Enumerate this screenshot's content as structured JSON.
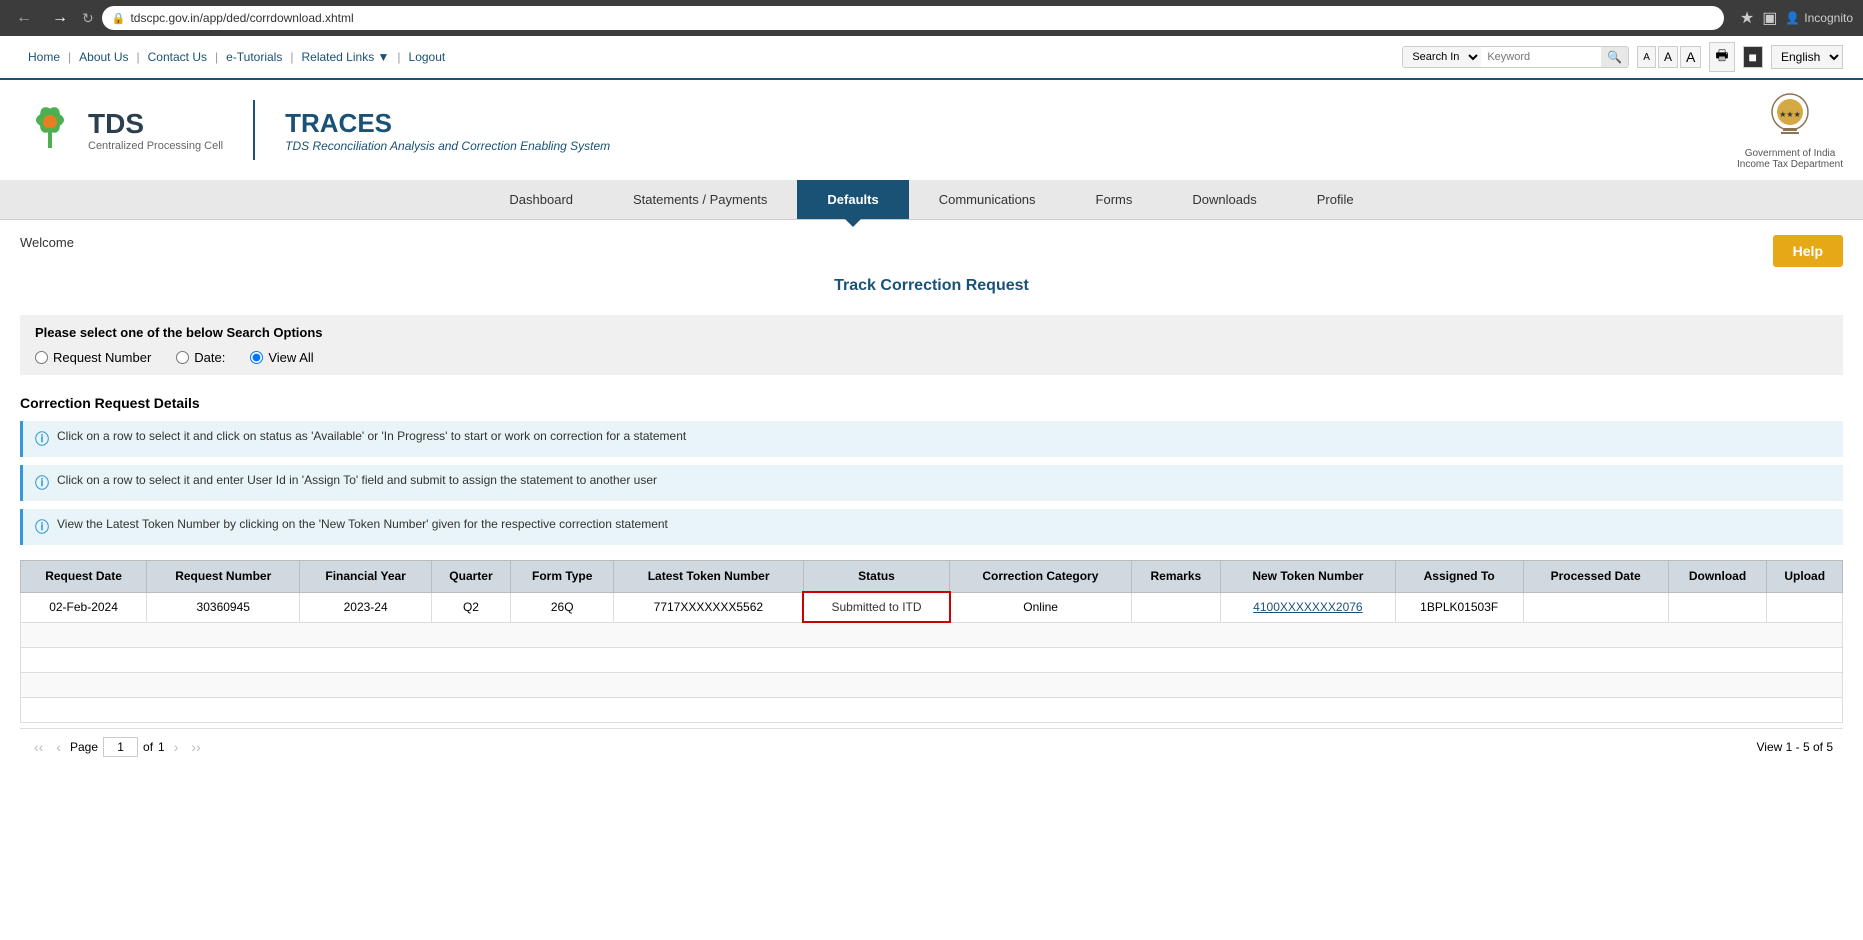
{
  "browser": {
    "url": "tdscpc.gov.in/app/ded/corrdownload.xhtml",
    "incognito_label": "Incognito"
  },
  "top_nav": {
    "links": [
      "Home",
      "About Us",
      "Contact Us",
      "e-Tutorials",
      "Related Links",
      "Logout"
    ],
    "search_label": "Search In",
    "search_placeholder": "Keyword",
    "font_btns": [
      "A",
      "A",
      "A"
    ],
    "language": "English"
  },
  "header": {
    "tds_title": "TDS",
    "tds_sub": "Centralized Processing Cell",
    "traces_title": "TRACES",
    "traces_sub": "TDS Reconciliation Analysis and Correction Enabling System",
    "govt_line1": "Government of India",
    "govt_line2": "Income Tax Department"
  },
  "main_nav": {
    "items": [
      "Dashboard",
      "Statements / Payments",
      "Defaults",
      "Communications",
      "Forms",
      "Downloads",
      "Profile"
    ],
    "active": "Defaults"
  },
  "content": {
    "welcome": "Welcome",
    "help_btn": "Help",
    "page_title": "Track Correction Request",
    "search_options_title": "Please select one of the below Search Options",
    "search_options": [
      "Request Number",
      "Date:",
      "View All"
    ],
    "selected_option": "View All",
    "correction_details_title": "Correction Request Details",
    "info_messages": [
      "Click on a row to select it and click on status as 'Available' or 'In Progress' to start or work on correction for a statement",
      "Click on a row to select it and enter User Id in 'Assign To' field and submit to assign the statement to another user",
      "View the Latest Token Number by clicking on the 'New Token Number' given for the respective correction statement"
    ],
    "table_headers": [
      "Request Date",
      "Request Number",
      "Financial Year",
      "Quarter",
      "Form Type",
      "Latest Token Number",
      "Status",
      "Correction Category",
      "Remarks",
      "New Token Number",
      "Assigned To",
      "Processed Date",
      "Download",
      "Upload"
    ],
    "table_rows": [
      {
        "request_date": "02-Feb-2024",
        "request_number": "30360945",
        "financial_year": "2023-24",
        "quarter": "Q2",
        "form_type": "26Q",
        "latest_token": "7717XXXXXXX5562",
        "status": "Submitted to ITD",
        "correction_category": "Online",
        "remarks": "",
        "new_token_number": "4100XXXXXXX2076",
        "assigned_to": "1BPLK01503F",
        "processed_date": "",
        "download": "",
        "upload": ""
      }
    ],
    "pagination": {
      "page_label": "Page",
      "current_page": "1",
      "total_pages": "1",
      "view_range": "View 1 - 5 of 5"
    }
  }
}
